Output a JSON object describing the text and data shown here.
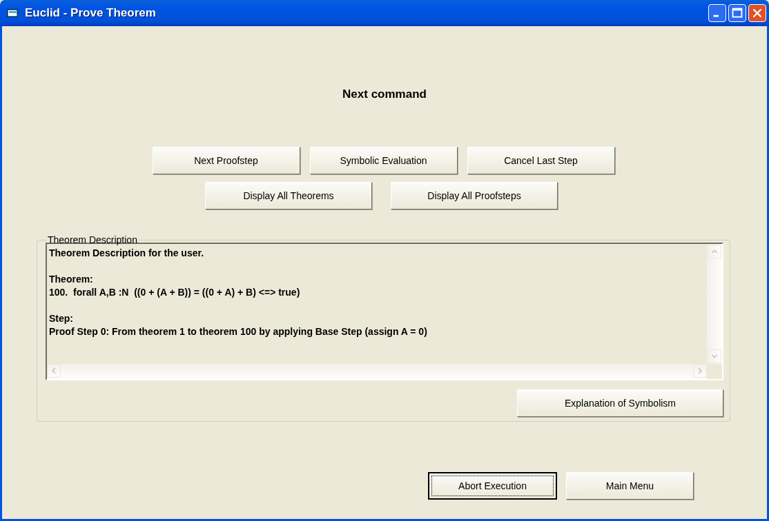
{
  "window": {
    "title": "Euclid - Prove Theorem"
  },
  "heading": "Next command",
  "command_rows": [
    [
      "Next Proofstep",
      "Symbolic Evaluation",
      "Cancel Last Step"
    ],
    [
      "Display All Theorems",
      "Display All Proofsteps"
    ]
  ],
  "theorem_description": {
    "legend": "Theorem Description",
    "paragraphs": [
      [
        "Theorem Description for the user."
      ],
      [
        "Theorem:",
        "100.  forall A,B :N  ((0 + (A + B)) = ((0 + A) + B) <=> true)"
      ],
      [
        "Step:",
        "Proof Step 0: From theorem 1 to theorem 100 by applying Base Step (assign A = 0)"
      ]
    ],
    "button": "Explanation of Symbolism"
  },
  "bottom_buttons": [
    {
      "label": "Abort Execution",
      "focused": true
    },
    {
      "label": "Main Menu",
      "focused": false
    }
  ]
}
